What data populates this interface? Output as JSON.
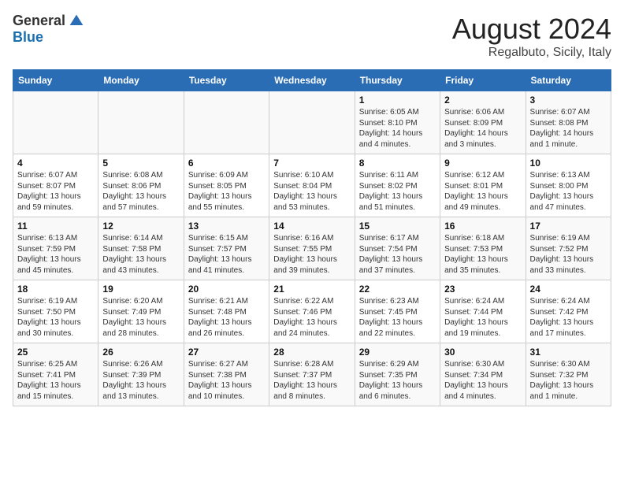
{
  "header": {
    "logo_general": "General",
    "logo_blue": "Blue",
    "month": "August 2024",
    "location": "Regalbuto, Sicily, Italy"
  },
  "weekdays": [
    "Sunday",
    "Monday",
    "Tuesday",
    "Wednesday",
    "Thursday",
    "Friday",
    "Saturday"
  ],
  "weeks": [
    [
      {
        "day": "",
        "sunrise": "",
        "sunset": "",
        "daylight": ""
      },
      {
        "day": "",
        "sunrise": "",
        "sunset": "",
        "daylight": ""
      },
      {
        "day": "",
        "sunrise": "",
        "sunset": "",
        "daylight": ""
      },
      {
        "day": "",
        "sunrise": "",
        "sunset": "",
        "daylight": ""
      },
      {
        "day": "1",
        "sunrise": "6:05 AM",
        "sunset": "8:10 PM",
        "daylight": "14 hours and 4 minutes."
      },
      {
        "day": "2",
        "sunrise": "6:06 AM",
        "sunset": "8:09 PM",
        "daylight": "14 hours and 3 minutes."
      },
      {
        "day": "3",
        "sunrise": "6:07 AM",
        "sunset": "8:08 PM",
        "daylight": "14 hours and 1 minute."
      }
    ],
    [
      {
        "day": "4",
        "sunrise": "6:07 AM",
        "sunset": "8:07 PM",
        "daylight": "13 hours and 59 minutes."
      },
      {
        "day": "5",
        "sunrise": "6:08 AM",
        "sunset": "8:06 PM",
        "daylight": "13 hours and 57 minutes."
      },
      {
        "day": "6",
        "sunrise": "6:09 AM",
        "sunset": "8:05 PM",
        "daylight": "13 hours and 55 minutes."
      },
      {
        "day": "7",
        "sunrise": "6:10 AM",
        "sunset": "8:04 PM",
        "daylight": "13 hours and 53 minutes."
      },
      {
        "day": "8",
        "sunrise": "6:11 AM",
        "sunset": "8:02 PM",
        "daylight": "13 hours and 51 minutes."
      },
      {
        "day": "9",
        "sunrise": "6:12 AM",
        "sunset": "8:01 PM",
        "daylight": "13 hours and 49 minutes."
      },
      {
        "day": "10",
        "sunrise": "6:13 AM",
        "sunset": "8:00 PM",
        "daylight": "13 hours and 47 minutes."
      }
    ],
    [
      {
        "day": "11",
        "sunrise": "6:13 AM",
        "sunset": "7:59 PM",
        "daylight": "13 hours and 45 minutes."
      },
      {
        "day": "12",
        "sunrise": "6:14 AM",
        "sunset": "7:58 PM",
        "daylight": "13 hours and 43 minutes."
      },
      {
        "day": "13",
        "sunrise": "6:15 AM",
        "sunset": "7:57 PM",
        "daylight": "13 hours and 41 minutes."
      },
      {
        "day": "14",
        "sunrise": "6:16 AM",
        "sunset": "7:55 PM",
        "daylight": "13 hours and 39 minutes."
      },
      {
        "day": "15",
        "sunrise": "6:17 AM",
        "sunset": "7:54 PM",
        "daylight": "13 hours and 37 minutes."
      },
      {
        "day": "16",
        "sunrise": "6:18 AM",
        "sunset": "7:53 PM",
        "daylight": "13 hours and 35 minutes."
      },
      {
        "day": "17",
        "sunrise": "6:19 AM",
        "sunset": "7:52 PM",
        "daylight": "13 hours and 33 minutes."
      }
    ],
    [
      {
        "day": "18",
        "sunrise": "6:19 AM",
        "sunset": "7:50 PM",
        "daylight": "13 hours and 30 minutes."
      },
      {
        "day": "19",
        "sunrise": "6:20 AM",
        "sunset": "7:49 PM",
        "daylight": "13 hours and 28 minutes."
      },
      {
        "day": "20",
        "sunrise": "6:21 AM",
        "sunset": "7:48 PM",
        "daylight": "13 hours and 26 minutes."
      },
      {
        "day": "21",
        "sunrise": "6:22 AM",
        "sunset": "7:46 PM",
        "daylight": "13 hours and 24 minutes."
      },
      {
        "day": "22",
        "sunrise": "6:23 AM",
        "sunset": "7:45 PM",
        "daylight": "13 hours and 22 minutes."
      },
      {
        "day": "23",
        "sunrise": "6:24 AM",
        "sunset": "7:44 PM",
        "daylight": "13 hours and 19 minutes."
      },
      {
        "day": "24",
        "sunrise": "6:24 AM",
        "sunset": "7:42 PM",
        "daylight": "13 hours and 17 minutes."
      }
    ],
    [
      {
        "day": "25",
        "sunrise": "6:25 AM",
        "sunset": "7:41 PM",
        "daylight": "13 hours and 15 minutes."
      },
      {
        "day": "26",
        "sunrise": "6:26 AM",
        "sunset": "7:39 PM",
        "daylight": "13 hours and 13 minutes."
      },
      {
        "day": "27",
        "sunrise": "6:27 AM",
        "sunset": "7:38 PM",
        "daylight": "13 hours and 10 minutes."
      },
      {
        "day": "28",
        "sunrise": "6:28 AM",
        "sunset": "7:37 PM",
        "daylight": "13 hours and 8 minutes."
      },
      {
        "day": "29",
        "sunrise": "6:29 AM",
        "sunset": "7:35 PM",
        "daylight": "13 hours and 6 minutes."
      },
      {
        "day": "30",
        "sunrise": "6:30 AM",
        "sunset": "7:34 PM",
        "daylight": "13 hours and 4 minutes."
      },
      {
        "day": "31",
        "sunrise": "6:30 AM",
        "sunset": "7:32 PM",
        "daylight": "13 hours and 1 minute."
      }
    ]
  ],
  "labels": {
    "sunrise": "Sunrise:",
    "sunset": "Sunset:",
    "daylight": "Daylight:"
  }
}
